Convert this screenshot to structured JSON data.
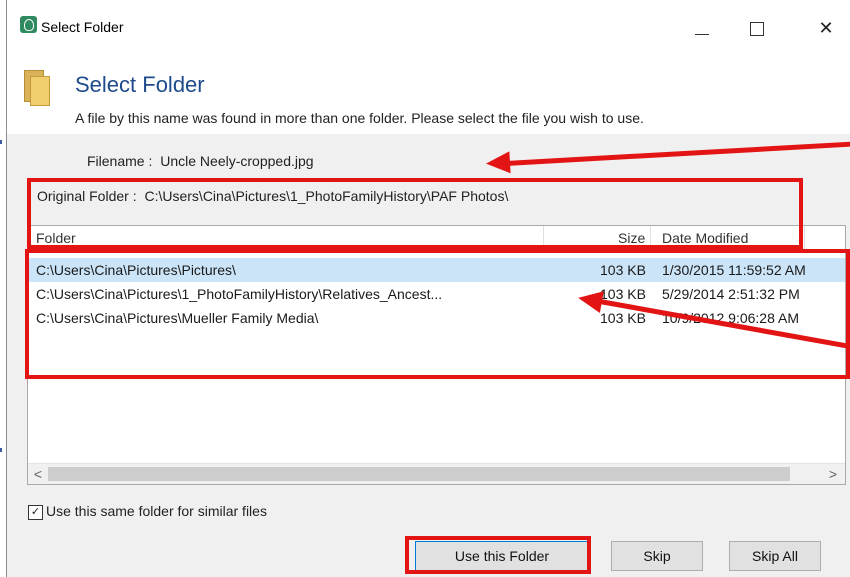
{
  "window": {
    "title": "Select Folder",
    "controls": {
      "minimize": "—",
      "close": "✕"
    }
  },
  "dialog": {
    "heading": "Select Folder",
    "description": "A file by this name was found in more than one folder.  Please select the file you wish to use."
  },
  "info": {
    "filename_label": "Filename :",
    "filename_value": "Uncle Neely-cropped.jpg",
    "original_label": "Original Folder :",
    "original_value": "C:\\Users\\Cina\\Pictures\\1_PhotoFamilyHistory\\PAF Photos\\"
  },
  "table": {
    "columns": [
      "Folder",
      "Size",
      "Date Modified"
    ],
    "rows": [
      [
        "C:\\Users\\Cina\\Pictures\\Pictures\\",
        "103 KB",
        "1/30/2015 11:59:52 AM"
      ],
      [
        "C:\\Users\\Cina\\Pictures\\1_PhotoFamilyHistory\\Relatives_Ancest...",
        "103 KB",
        "5/29/2014 2:51:32 PM"
      ],
      [
        "C:\\Users\\Cina\\Pictures\\Mueller Family Media\\",
        "103 KB",
        "10/9/2012 9:06:28 AM"
      ]
    ],
    "selected_row": 0,
    "scroll_left_arrow": "<",
    "scroll_right_arrow": ">"
  },
  "options": {
    "same_folder_label": "Use this same folder for similar files",
    "same_folder_checked": true,
    "check_mark": "✓"
  },
  "buttons": {
    "use_folder": "Use this Folder",
    "skip": "Skip",
    "skip_all": "Skip All"
  },
  "colors": {
    "annotation_red": "#e31414",
    "heading_blue": "#1e4b8c",
    "selection": "#cce4f7"
  }
}
